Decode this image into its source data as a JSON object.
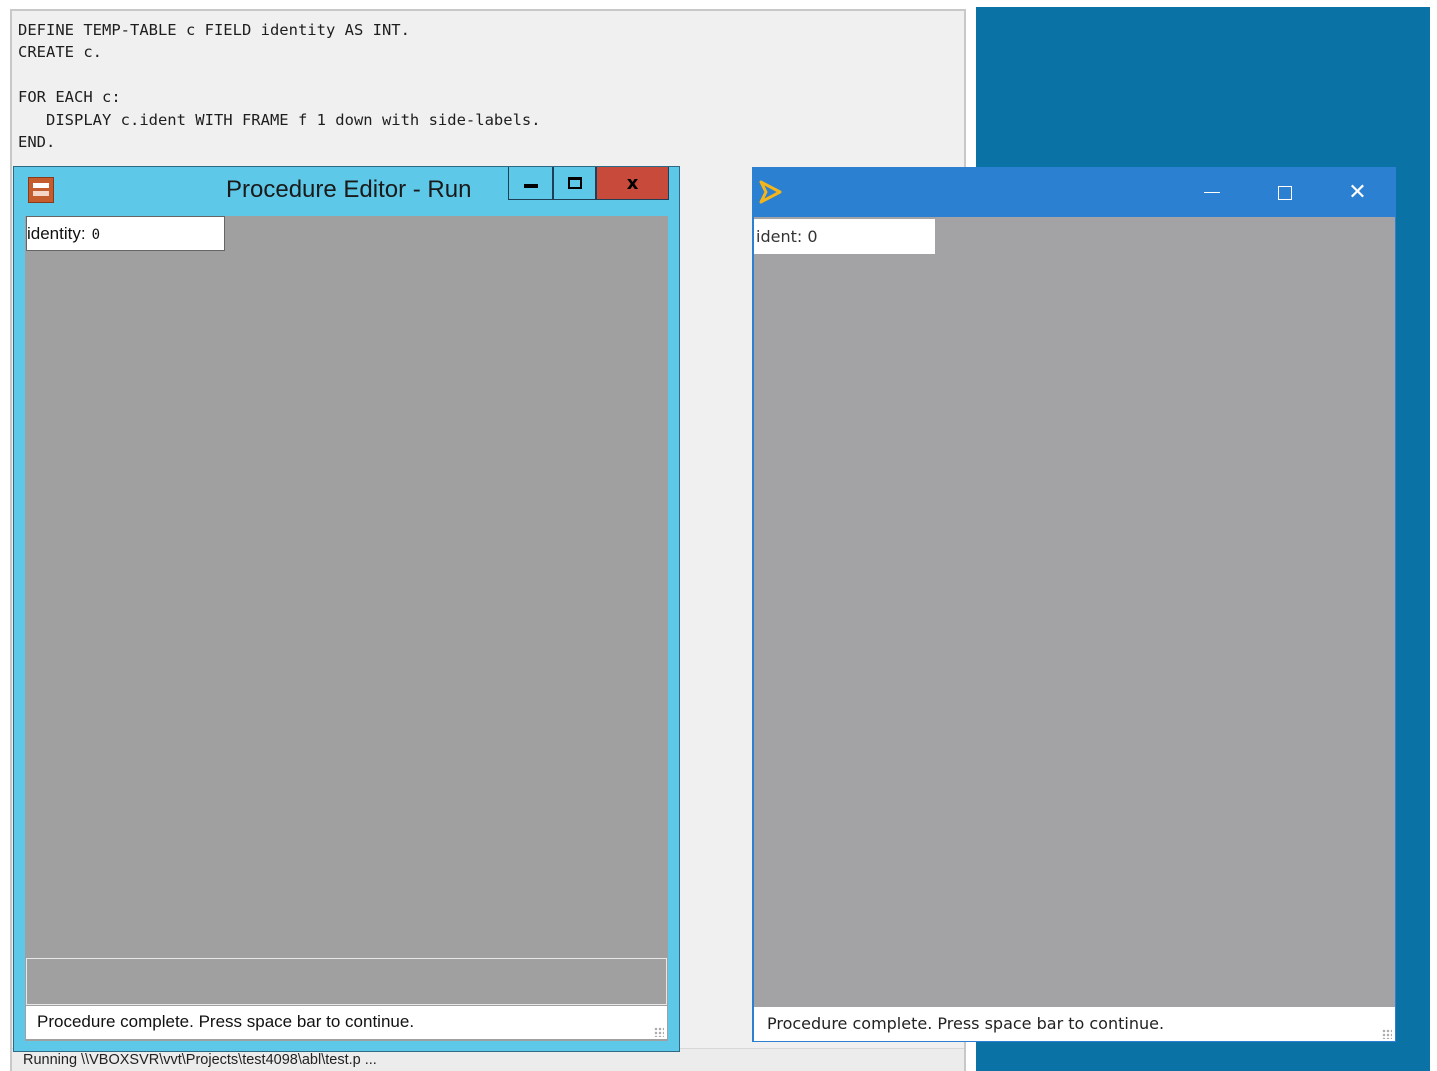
{
  "editor": {
    "code_lines": [
      "DEFINE TEMP-TABLE c FIELD identity AS INT.",
      "CREATE c.",
      "",
      "FOR EACH c:",
      "   DISPLAY c.ident WITH FRAME f 1 down with side-labels.",
      "END."
    ],
    "status_text": "Running \\\\VBOXSVR\\vvt\\Projects\\test4098\\abl\\test.p ..."
  },
  "left_window": {
    "title": "Procedure Editor - Run",
    "field_label": "identity:",
    "field_value": "0",
    "message": "Procedure complete. Press space bar to continue.",
    "close_label": "x"
  },
  "right_window": {
    "title": "",
    "field_label": "ident:",
    "field_value": "0",
    "message": "Procedure complete. Press space bar to continue.",
    "close_label": "✕"
  },
  "colors": {
    "desktop": "#0a72a4",
    "win8_frame": "#5ec8e8",
    "win8_close": "#c74a3a",
    "win10_titlebar": "#2b80d1",
    "client_gray": "#a0a0a0"
  },
  "icons": {
    "left_app": "procedure-editor-icon",
    "right_app": "progress-run-arrow-icon"
  }
}
